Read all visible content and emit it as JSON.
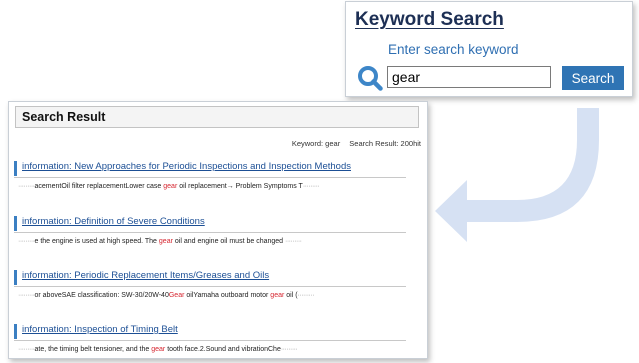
{
  "keyword_search": {
    "title": "Keyword Search",
    "prompt": "Enter search keyword",
    "input_value": "gear",
    "button_label": "Search",
    "magnifier_icon": "search-icon",
    "button_color": "#2f74b4"
  },
  "search_result": {
    "heading": "Search Result",
    "keyword_meta": "Keyword: gear",
    "count_meta": "Search Result: 200hit",
    "highlight_color": "#d6252f",
    "results": [
      {
        "title": "information: New Approaches for Periodic Inspections and Inspection Methods",
        "snippet_lead": "·········",
        "snippet_before": "acementOil filter replacementLower case ",
        "snippet_keyword": "gear",
        "snippet_after": " oil replacement→ Problem Symptoms T",
        "snippet_trail": "·········"
      },
      {
        "title": "information: Definition of Severe Conditions",
        "snippet_lead": "·········",
        "snippet_before": "e the engine is used at high speed. The ",
        "snippet_keyword": "gear",
        "snippet_after": " oil and engine oil must be changed ",
        "snippet_trail": "·········"
      },
      {
        "title": "information: Periodic Replacement Items/Greases and Oils",
        "snippet_lead": "·········",
        "snippet_before": "or aboveSAE classification: SW-30/20W-40",
        "snippet_keyword": "Gear",
        "snippet_middle": " oilYamaha outboard motor ",
        "snippet_keyword2": "gear",
        "snippet_after": " oil (",
        "snippet_trail": "·········"
      },
      {
        "title": "information: Inspection of Timing Belt",
        "snippet_lead": "·········",
        "snippet_before": "ate, the timing belt tensioner, and the ",
        "snippet_keyword": "gear",
        "snippet_after": " tooth face.2.Sound and vibrationChe",
        "snippet_trail": "·········"
      }
    ]
  }
}
